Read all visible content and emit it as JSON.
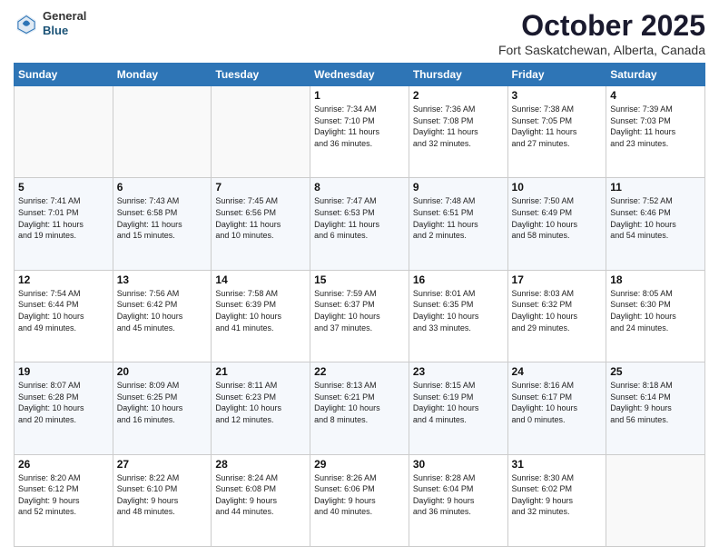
{
  "header": {
    "logo_general": "General",
    "logo_blue": "Blue",
    "month": "October 2025",
    "location": "Fort Saskatchewan, Alberta, Canada"
  },
  "days_of_week": [
    "Sunday",
    "Monday",
    "Tuesday",
    "Wednesday",
    "Thursday",
    "Friday",
    "Saturday"
  ],
  "weeks": [
    [
      {
        "day": "",
        "text": ""
      },
      {
        "day": "",
        "text": ""
      },
      {
        "day": "",
        "text": ""
      },
      {
        "day": "1",
        "text": "Sunrise: 7:34 AM\nSunset: 7:10 PM\nDaylight: 11 hours\nand 36 minutes."
      },
      {
        "day": "2",
        "text": "Sunrise: 7:36 AM\nSunset: 7:08 PM\nDaylight: 11 hours\nand 32 minutes."
      },
      {
        "day": "3",
        "text": "Sunrise: 7:38 AM\nSunset: 7:05 PM\nDaylight: 11 hours\nand 27 minutes."
      },
      {
        "day": "4",
        "text": "Sunrise: 7:39 AM\nSunset: 7:03 PM\nDaylight: 11 hours\nand 23 minutes."
      }
    ],
    [
      {
        "day": "5",
        "text": "Sunrise: 7:41 AM\nSunset: 7:01 PM\nDaylight: 11 hours\nand 19 minutes."
      },
      {
        "day": "6",
        "text": "Sunrise: 7:43 AM\nSunset: 6:58 PM\nDaylight: 11 hours\nand 15 minutes."
      },
      {
        "day": "7",
        "text": "Sunrise: 7:45 AM\nSunset: 6:56 PM\nDaylight: 11 hours\nand 10 minutes."
      },
      {
        "day": "8",
        "text": "Sunrise: 7:47 AM\nSunset: 6:53 PM\nDaylight: 11 hours\nand 6 minutes."
      },
      {
        "day": "9",
        "text": "Sunrise: 7:48 AM\nSunset: 6:51 PM\nDaylight: 11 hours\nand 2 minutes."
      },
      {
        "day": "10",
        "text": "Sunrise: 7:50 AM\nSunset: 6:49 PM\nDaylight: 10 hours\nand 58 minutes."
      },
      {
        "day": "11",
        "text": "Sunrise: 7:52 AM\nSunset: 6:46 PM\nDaylight: 10 hours\nand 54 minutes."
      }
    ],
    [
      {
        "day": "12",
        "text": "Sunrise: 7:54 AM\nSunset: 6:44 PM\nDaylight: 10 hours\nand 49 minutes."
      },
      {
        "day": "13",
        "text": "Sunrise: 7:56 AM\nSunset: 6:42 PM\nDaylight: 10 hours\nand 45 minutes."
      },
      {
        "day": "14",
        "text": "Sunrise: 7:58 AM\nSunset: 6:39 PM\nDaylight: 10 hours\nand 41 minutes."
      },
      {
        "day": "15",
        "text": "Sunrise: 7:59 AM\nSunset: 6:37 PM\nDaylight: 10 hours\nand 37 minutes."
      },
      {
        "day": "16",
        "text": "Sunrise: 8:01 AM\nSunset: 6:35 PM\nDaylight: 10 hours\nand 33 minutes."
      },
      {
        "day": "17",
        "text": "Sunrise: 8:03 AM\nSunset: 6:32 PM\nDaylight: 10 hours\nand 29 minutes."
      },
      {
        "day": "18",
        "text": "Sunrise: 8:05 AM\nSunset: 6:30 PM\nDaylight: 10 hours\nand 24 minutes."
      }
    ],
    [
      {
        "day": "19",
        "text": "Sunrise: 8:07 AM\nSunset: 6:28 PM\nDaylight: 10 hours\nand 20 minutes."
      },
      {
        "day": "20",
        "text": "Sunrise: 8:09 AM\nSunset: 6:25 PM\nDaylight: 10 hours\nand 16 minutes."
      },
      {
        "day": "21",
        "text": "Sunrise: 8:11 AM\nSunset: 6:23 PM\nDaylight: 10 hours\nand 12 minutes."
      },
      {
        "day": "22",
        "text": "Sunrise: 8:13 AM\nSunset: 6:21 PM\nDaylight: 10 hours\nand 8 minutes."
      },
      {
        "day": "23",
        "text": "Sunrise: 8:15 AM\nSunset: 6:19 PM\nDaylight: 10 hours\nand 4 minutes."
      },
      {
        "day": "24",
        "text": "Sunrise: 8:16 AM\nSunset: 6:17 PM\nDaylight: 10 hours\nand 0 minutes."
      },
      {
        "day": "25",
        "text": "Sunrise: 8:18 AM\nSunset: 6:14 PM\nDaylight: 9 hours\nand 56 minutes."
      }
    ],
    [
      {
        "day": "26",
        "text": "Sunrise: 8:20 AM\nSunset: 6:12 PM\nDaylight: 9 hours\nand 52 minutes."
      },
      {
        "day": "27",
        "text": "Sunrise: 8:22 AM\nSunset: 6:10 PM\nDaylight: 9 hours\nand 48 minutes."
      },
      {
        "day": "28",
        "text": "Sunrise: 8:24 AM\nSunset: 6:08 PM\nDaylight: 9 hours\nand 44 minutes."
      },
      {
        "day": "29",
        "text": "Sunrise: 8:26 AM\nSunset: 6:06 PM\nDaylight: 9 hours\nand 40 minutes."
      },
      {
        "day": "30",
        "text": "Sunrise: 8:28 AM\nSunset: 6:04 PM\nDaylight: 9 hours\nand 36 minutes."
      },
      {
        "day": "31",
        "text": "Sunrise: 8:30 AM\nSunset: 6:02 PM\nDaylight: 9 hours\nand 32 minutes."
      },
      {
        "day": "",
        "text": ""
      }
    ]
  ]
}
